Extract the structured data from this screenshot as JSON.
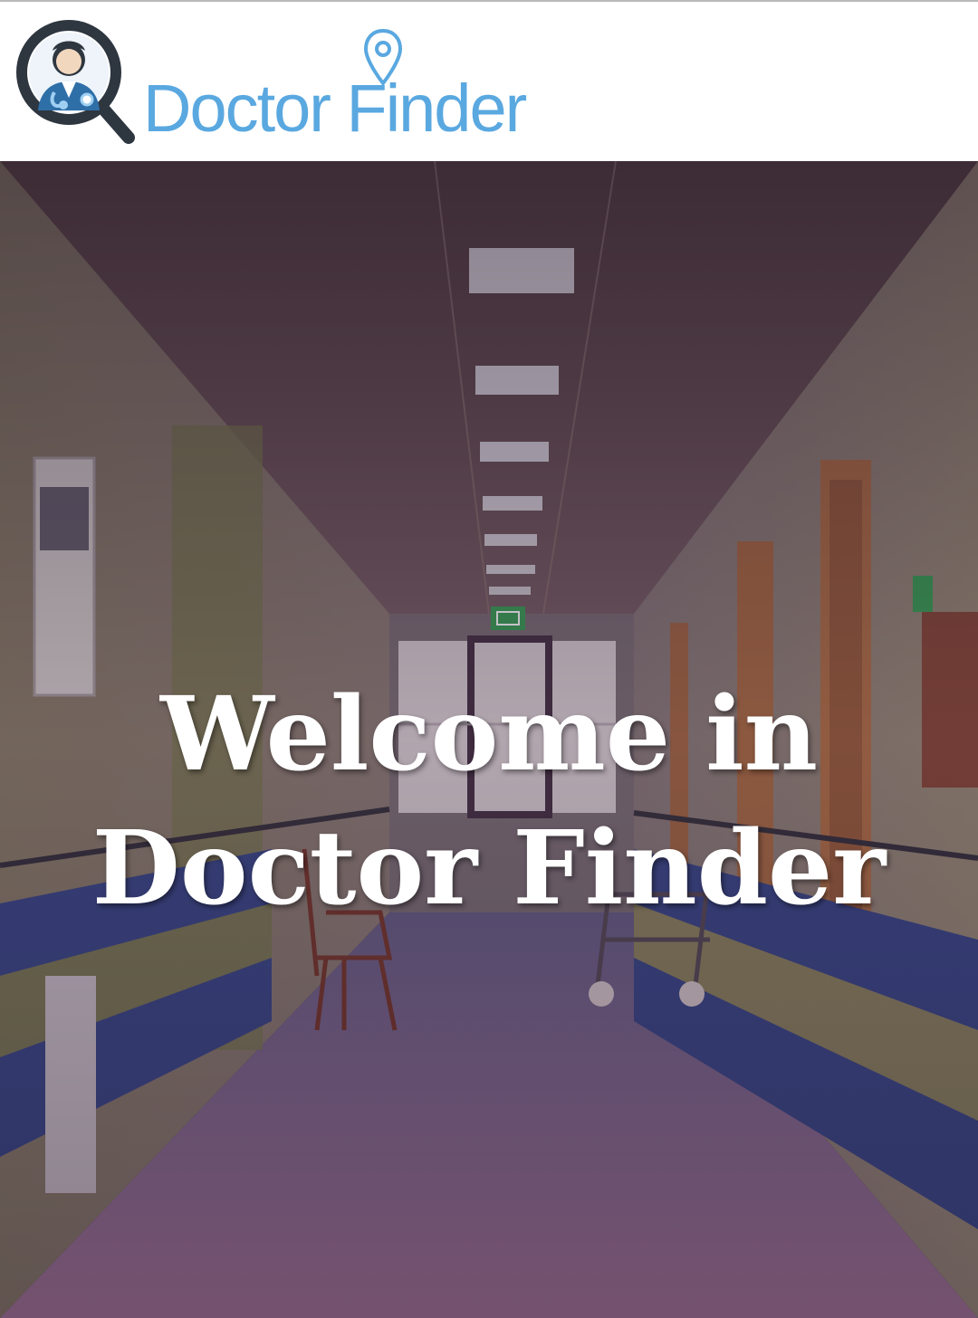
{
  "header": {
    "brand_name": "Doctor Finder",
    "logo_icon": "doctor-magnifier-icon",
    "pin_icon": "location-pin-icon",
    "brand_color": "#5aa8e0"
  },
  "hero": {
    "title_line1": "Welcome in",
    "title_line2": "Doctor Finder",
    "background": "hospital-corridor-image",
    "exit_sign_icon": "exit-sign-icon"
  }
}
